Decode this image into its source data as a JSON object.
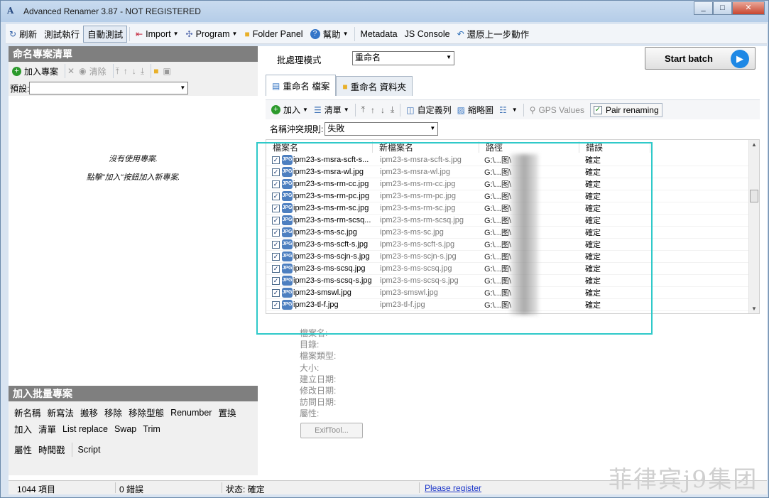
{
  "window": {
    "title": "Advanced Renamer 3.87 - NOT REGISTERED",
    "min": "_",
    "max": "□",
    "close": "✕"
  },
  "toolbar": {
    "refresh": "刷新",
    "test_run": "測試執行",
    "auto_test": "自動測試",
    "import": "Import",
    "program": "Program",
    "folder_panel": "Folder Panel",
    "help": "幫助",
    "metadata": "Metadata",
    "js_console": "JS Console",
    "undo": "還原上一步動作"
  },
  "left": {
    "header": "命名專案清單",
    "add_project": "加入專案",
    "clear": "清除",
    "preset_label": "預設:",
    "preset_value": "",
    "empty_line1": "沒有使用專案.",
    "empty_line2": "點擊\"加入\"按鈕加入新專案."
  },
  "batch": {
    "header": "加入批量專案",
    "row1": [
      "新名稱",
      "新寫法",
      "搬移",
      "移除",
      "移除型態",
      "Renumber",
      "置換"
    ],
    "row2": [
      "加入",
      "清單",
      "List replace",
      "Swap",
      "Trim"
    ],
    "row3": [
      "屬性",
      "時間戳"
    ],
    "row3_extra": "Script"
  },
  "right": {
    "mode_label": "批處理模式",
    "mode_value": "重命名",
    "start_batch": "Start batch",
    "tab_files": "重命名 檔案",
    "tab_folders": "重命名 資料夾",
    "add": "加入",
    "list": "清單",
    "custom_columns": "自定義列",
    "thumbnails": "縮略圖",
    "gps_values": "GPS Values",
    "pair_renaming": "Pair renaming",
    "conflict_label": "名稱沖突規則:",
    "conflict_value": "失敗"
  },
  "grid": {
    "columns": [
      "檔案名",
      "新檔案名",
      "路徑",
      "錯誤"
    ],
    "rows": [
      {
        "name": "ipm23-s-msra-scft-s...",
        "new": "ipm23-s-msra-scft-s.jpg",
        "path": "G:\\...图\\",
        "err": "確定"
      },
      {
        "name": "ipm23-s-msra-wl.jpg",
        "new": "ipm23-s-msra-wl.jpg",
        "path": "G:\\...图\\",
        "err": "確定"
      },
      {
        "name": "ipm23-s-ms-rm-cc.jpg",
        "new": "ipm23-s-ms-rm-cc.jpg",
        "path": "G:\\...图\\",
        "err": "確定"
      },
      {
        "name": "ipm23-s-ms-rm-pc.jpg",
        "new": "ipm23-s-ms-rm-pc.jpg",
        "path": "G:\\...图\\",
        "err": "確定"
      },
      {
        "name": "ipm23-s-ms-rm-sc.jpg",
        "new": "ipm23-s-ms-rm-sc.jpg",
        "path": "G:\\...图\\",
        "err": "確定"
      },
      {
        "name": "ipm23-s-ms-rm-scsq...",
        "new": "ipm23-s-ms-rm-scsq.jpg",
        "path": "G:\\...图\\",
        "err": "確定"
      },
      {
        "name": "ipm23-s-ms-sc.jpg",
        "new": "ipm23-s-ms-sc.jpg",
        "path": "G:\\...图\\",
        "err": "確定"
      },
      {
        "name": "ipm23-s-ms-scft-s.jpg",
        "new": "ipm23-s-ms-scft-s.jpg",
        "path": "G:\\...图\\",
        "err": "確定"
      },
      {
        "name": "ipm23-s-ms-scjn-s.jpg",
        "new": "ipm23-s-ms-scjn-s.jpg",
        "path": "G:\\...图\\",
        "err": "確定"
      },
      {
        "name": "ipm23-s-ms-scsq.jpg",
        "new": "ipm23-s-ms-scsq.jpg",
        "path": "G:\\...图\\",
        "err": "確定"
      },
      {
        "name": "ipm23-s-ms-scsq-s.jpg",
        "new": "ipm23-s-ms-scsq-s.jpg",
        "path": "G:\\...图\\",
        "err": "確定"
      },
      {
        "name": "ipm23-smswl.jpg",
        "new": "ipm23-smswl.jpg",
        "path": "G:\\...图\\",
        "err": "確定"
      },
      {
        "name": "ipm23-tl-f.jpg",
        "new": "ipm23-tl-f.jpg",
        "path": "G:\\...图\\",
        "err": "確定"
      }
    ]
  },
  "info": {
    "filename": "檔案名:",
    "directory": "目錄:",
    "filetype": "檔案類型:",
    "size": "大小:",
    "created": "建立日期:",
    "modified": "修改日期:",
    "accessed": "訪問日期:",
    "attributes": "屬性:",
    "exiftool": "ExifTool..."
  },
  "status": {
    "items": "1044 項目",
    "errors": "0 錯誤",
    "state": "状态: 確定",
    "register": "Please register"
  },
  "watermark": "菲律宾j9集团",
  "colors": {
    "highlight": "#2fc9c9",
    "header_bg": "#7f7f7f",
    "link": "#1a35c9",
    "play_button": "#1e88e5"
  }
}
